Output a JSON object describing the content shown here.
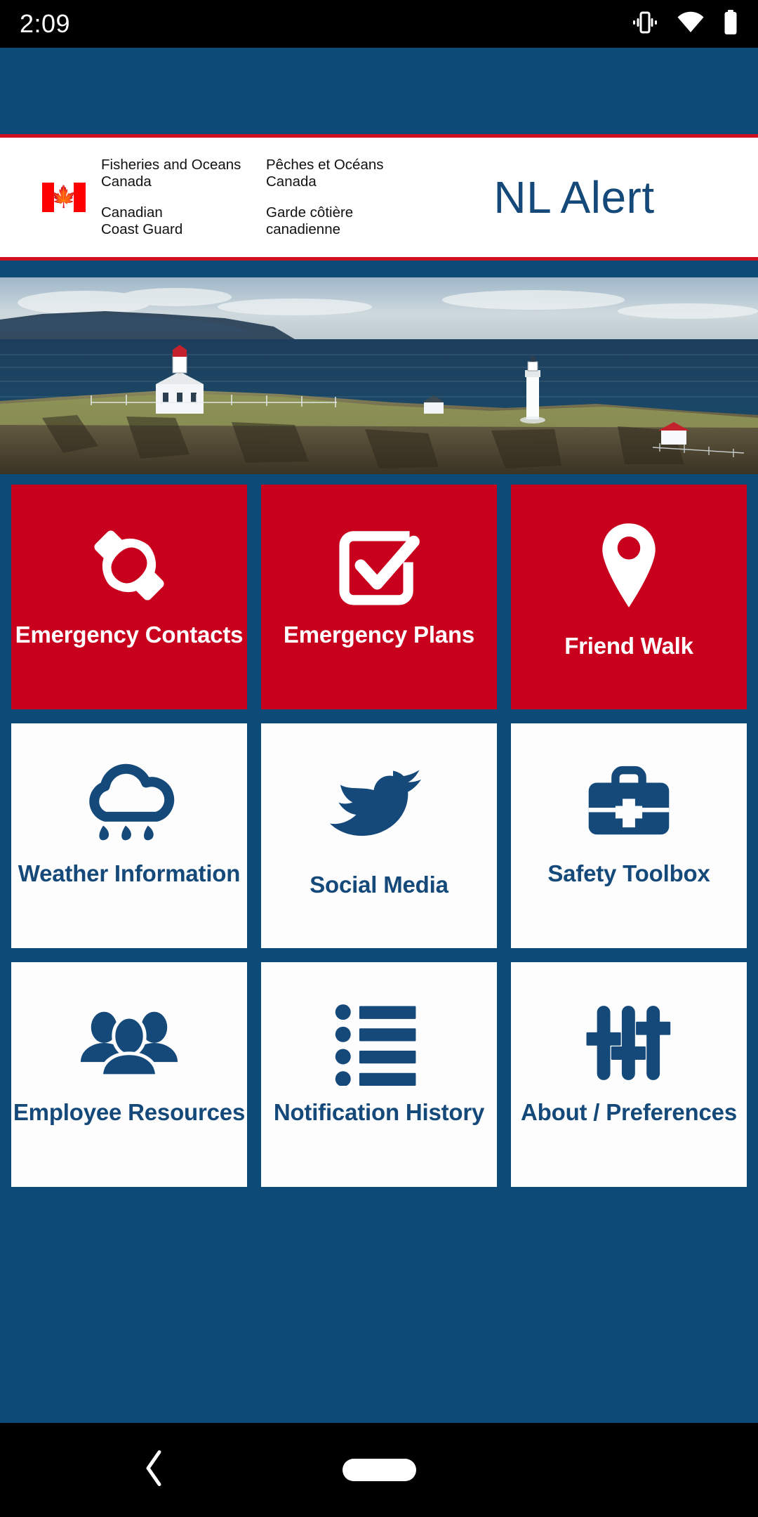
{
  "statusbar": {
    "clock": "2:09",
    "icons": [
      "vibrate-icon",
      "wifi-icon",
      "battery-icon"
    ]
  },
  "header": {
    "flag": "canada-flag-icon",
    "wordmark_en": {
      "line1": "Fisheries and Oceans",
      "line2": "Canada",
      "line3": "Canadian",
      "line4": "Coast Guard"
    },
    "wordmark_fr": {
      "line1": "Pêches et Océans",
      "line2": "Canada",
      "line3": "Garde côtière",
      "line4": "canadienne"
    },
    "app_title": "NL Alert"
  },
  "hero": {
    "name": "lighthouse-coastline-banner"
  },
  "grid": {
    "tiles": [
      {
        "label": "Emergency Contacts",
        "icon": "phone-handset-icon",
        "style": "red",
        "lines": 2
      },
      {
        "label": "Emergency Plans",
        "icon": "checkbox-check-icon",
        "style": "red",
        "lines": 2
      },
      {
        "label": "Friend Walk",
        "icon": "map-pin-icon",
        "style": "red",
        "lines": 1
      },
      {
        "label": "Weather Information",
        "icon": "rain-cloud-icon",
        "style": "white",
        "lines": 2
      },
      {
        "label": "Social Media",
        "icon": "bird-icon",
        "style": "white",
        "lines": 1
      },
      {
        "label": "Safety Toolbox",
        "icon": "first-aid-kit-icon",
        "style": "white",
        "lines": 2
      },
      {
        "label": "Employee Resources",
        "icon": "people-group-icon",
        "style": "white",
        "lines": 2
      },
      {
        "label": "Notification History",
        "icon": "bullet-list-icon",
        "style": "white",
        "lines": 2
      },
      {
        "label": "About / Preferences",
        "icon": "sliders-icon",
        "style": "white",
        "lines": 2
      }
    ]
  },
  "navbar": {
    "back": "back-chevron-icon",
    "home": "home-pill-icon"
  },
  "colors": {
    "navy": "#0c4a78",
    "brand_blue": "#14497a",
    "red_tile": "#c8001e",
    "accent_red": "#d01021",
    "white": "#ffffff",
    "black": "#000000"
  }
}
